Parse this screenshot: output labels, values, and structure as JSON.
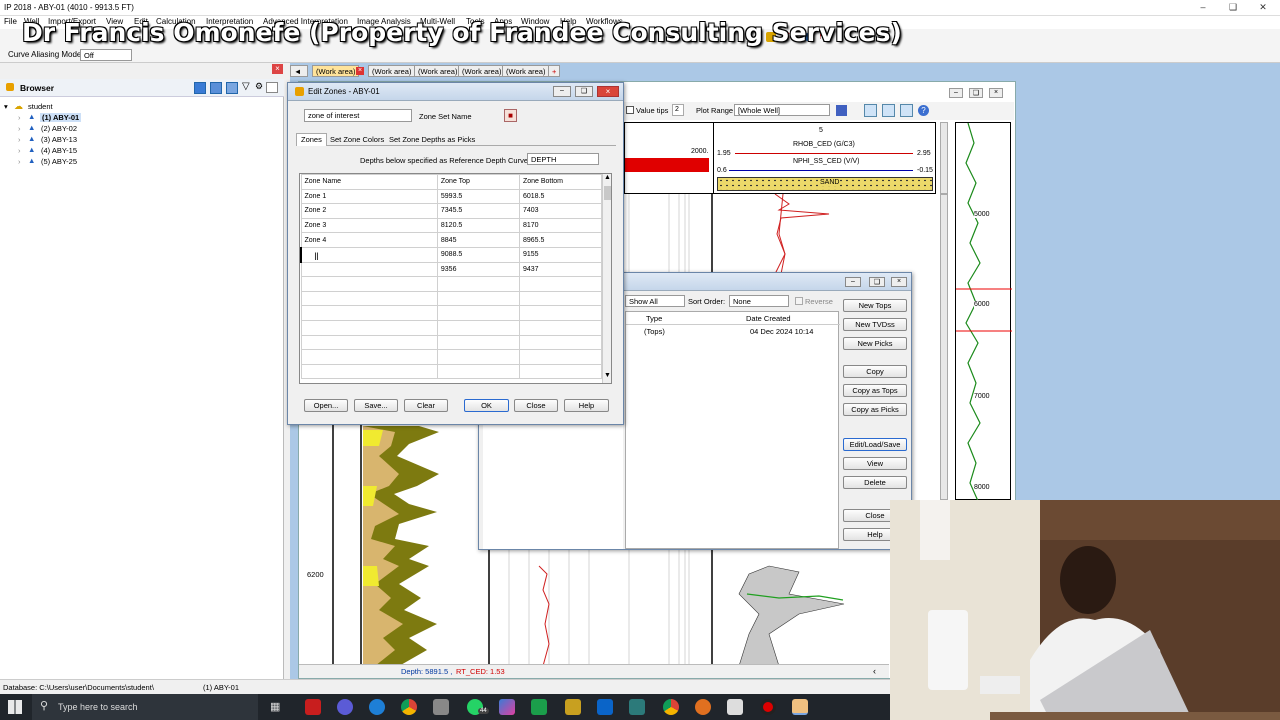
{
  "app": {
    "title": "IP 2018 - ABY-01 (4010 - 9913.5 FT)",
    "watermark": "Dr Francis Omonefe (Property of Frandee Consulting Services)",
    "menu": [
      "File",
      "Well",
      "Import/Export",
      "View",
      "Edit",
      "Calculation",
      "Interpretation",
      "Advanced Interpretation",
      "Image Analysis",
      "Multi-Well",
      "Tools",
      "Apps",
      "Window",
      "Help",
      "Workflows"
    ],
    "curve_aliasing_label": "Curve Aliasing Mode :",
    "curve_aliasing_value": "Off"
  },
  "browser": {
    "title": "Browser",
    "root": "student",
    "wells": [
      "(1) ABY-01",
      "(2) ABY-02",
      "(3) ABY-13",
      "(4) ABY-15",
      "(5) ABY-25"
    ]
  },
  "tabs": [
    "(Work area)",
    "(Work area)",
    "(Work area)",
    "(Work area)",
    "(Work area)"
  ],
  "log_window": {
    "value_tips_label": "Value tips",
    "value_tips_value": "2",
    "plot_range_label": "Plot Range",
    "plot_range_value": "[Whole Well]",
    "track_number": "5",
    "track1_scale_right": "2000.",
    "rhob_label": "RHOB_CED (G/C3)",
    "rhob_min": "1.95",
    "rhob_max": "2.95",
    "nphi_label": "NPHI_SS_CED (V/V)",
    "nphi_min": "0.6",
    "nphi_max": "-0.15",
    "sand_label": "SAND",
    "depth_label": "6200",
    "mini_depths": [
      "5000",
      "6000",
      "7000",
      "8000"
    ],
    "status": "Depth: 5891.5 ,",
    "status_curve": "RT_CED: 1.53"
  },
  "tops_dialog": {
    "show_value": "Show All",
    "sort_label": "Sort Order:",
    "sort_value": "None",
    "reverse_label": "Reverse",
    "col_type": "Type",
    "col_date": "Date Created",
    "row_type": "(Tops)",
    "row_date": "04 Dec 2024 10:14",
    "buttons": [
      "New Tops",
      "New TVDss",
      "New Picks",
      "Copy",
      "Copy as Tops",
      "Copy as Picks",
      "Edit/Load/Save",
      "View",
      "Delete",
      "Close",
      "Help"
    ]
  },
  "edit_zones": {
    "title": "Edit Zones - ABY-01",
    "zone_set_value": "zone of interest",
    "zone_set_label": "Zone Set Name",
    "tabs": [
      "Zones",
      "Set Zone Colors",
      "Set Zone Depths as Picks"
    ],
    "depth_curve_label": "Depths below specified as Reference Depth Curve:",
    "depth_curve_value": "DEPTH",
    "columns": [
      "Zone Name",
      "Zone Top",
      "Zone Bottom"
    ],
    "rows": [
      [
        "Zone 1",
        "5993.5",
        "6018.5"
      ],
      [
        "Zone 2",
        "7345.5",
        "7403"
      ],
      [
        "Zone 3",
        "8120.5",
        "8170"
      ],
      [
        "Zone 4",
        "8845",
        "8965.5"
      ],
      [
        "",
        "9088.5",
        "9155"
      ],
      [
        "",
        "9356",
        "9437"
      ]
    ],
    "buttons": {
      "open": "Open...",
      "save": "Save...",
      "clear": "Clear",
      "ok": "OK",
      "close": "Close",
      "help": "Help"
    }
  },
  "statusbar": {
    "database": "Database: C:\\Users\\user\\Documents\\student\\",
    "well": "(1) ABY-01"
  },
  "taskbar": {
    "search_placeholder": "Type here to search",
    "badge": "44"
  }
}
